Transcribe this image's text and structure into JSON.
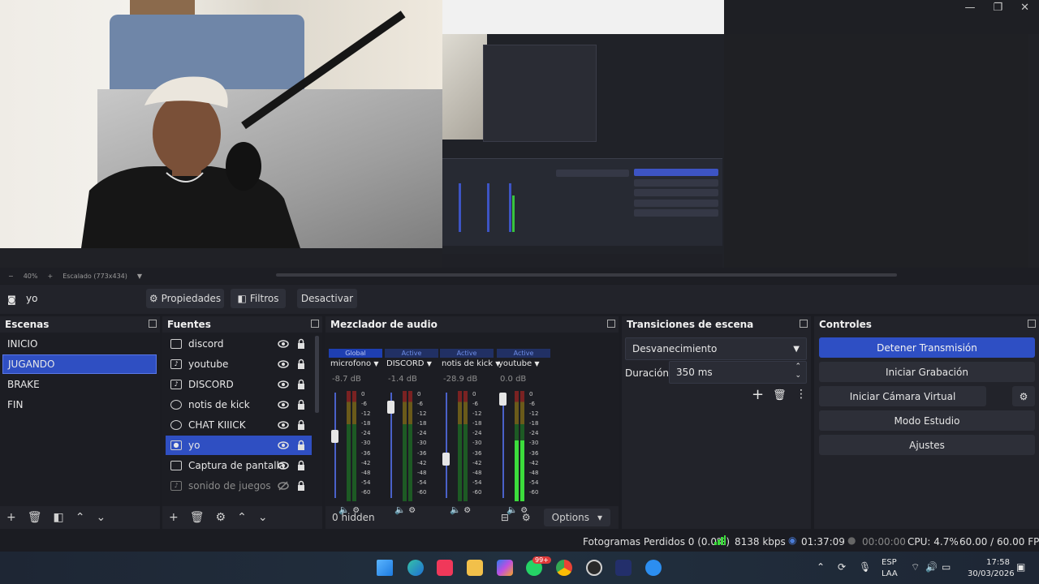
{
  "preview": {
    "zoom": "40%",
    "scaling": "Escalado (773x434)",
    "zoom_minus": "−",
    "zoom_plus": "+"
  },
  "source_toolbar": {
    "selected_source": "yo",
    "properties_label": "Propiedades",
    "filters_label": "Filtros",
    "deactivate_label": "Desactivar"
  },
  "scenes": {
    "title": "Escenas",
    "items": [
      "INICIO",
      "JUGANDO",
      "BRAKE",
      "FIN"
    ],
    "selected": "JUGANDO"
  },
  "sources": {
    "title": "Fuentes",
    "items": [
      {
        "label": "discord",
        "icon": "window-icon"
      },
      {
        "label": "youtube",
        "icon": "speaker-icon"
      },
      {
        "label": "DISCORD",
        "icon": "speaker-icon"
      },
      {
        "label": "notis de kick",
        "icon": "globe-icon"
      },
      {
        "label": "CHAT KIIICK",
        "icon": "globe-icon"
      },
      {
        "label": "yo",
        "icon": "camera-icon"
      },
      {
        "label": "Captura de pantalla",
        "icon": "monitor-icon"
      },
      {
        "label": "sonido de juegos",
        "icon": "speaker-icon"
      }
    ],
    "selected": "yo"
  },
  "mixer": {
    "title": "Mezclador de audio",
    "channels": [
      {
        "badge": "Global",
        "name": "microfono",
        "db": "-8.7 dB",
        "fader": 0.62,
        "level": 0.0
      },
      {
        "badge": "Active",
        "name": "DISCORD",
        "db": "-1.4 dB",
        "fader": 0.92,
        "level": 0.0
      },
      {
        "badge": "Active",
        "name": "notis de kick",
        "db": "-28.9 dB",
        "fader": 0.38,
        "level": 0.0
      },
      {
        "badge": "Active",
        "name": "youtube",
        "db": "0.0 dB",
        "fader": 1.0,
        "level": 0.55
      }
    ],
    "scale": [
      "0",
      "-6",
      "-12",
      "-18",
      "-24",
      "-30",
      "-36",
      "-42",
      "-48",
      "-54",
      "-60"
    ],
    "hidden_label": "0 hidden",
    "options_label": "Options"
  },
  "transitions": {
    "title": "Transiciones de escena",
    "selected": "Desvanecimiento",
    "duration_label": "Duración",
    "duration_value": "350 ms"
  },
  "controls": {
    "title": "Controles",
    "stop_stream": "Detener Transmisión",
    "start_recording": "Iniciar Grabación",
    "start_virtual_cam": "Iniciar Cámara Virtual",
    "studio_mode": "Modo Estudio",
    "settings": "Ajustes"
  },
  "status": {
    "dropped_frames": "Fotogramas Perdidos 0 (0.0%)",
    "bitrate": "8138 kbps",
    "stream_time": "01:37:09",
    "record_time": "00:00:00",
    "cpu": "CPU: 4.7%",
    "fps": "60.00 / 60.00 FPS"
  },
  "taskbar": {
    "lang_top": "ESP",
    "lang_bottom": "LAA",
    "time": "17:58",
    "date": "30/03/2026",
    "whatsapp_badge": "99+"
  },
  "colors": {
    "accent": "#2e4fc4",
    "panel": "#22232a",
    "meter_green": "#3cdc3c"
  }
}
